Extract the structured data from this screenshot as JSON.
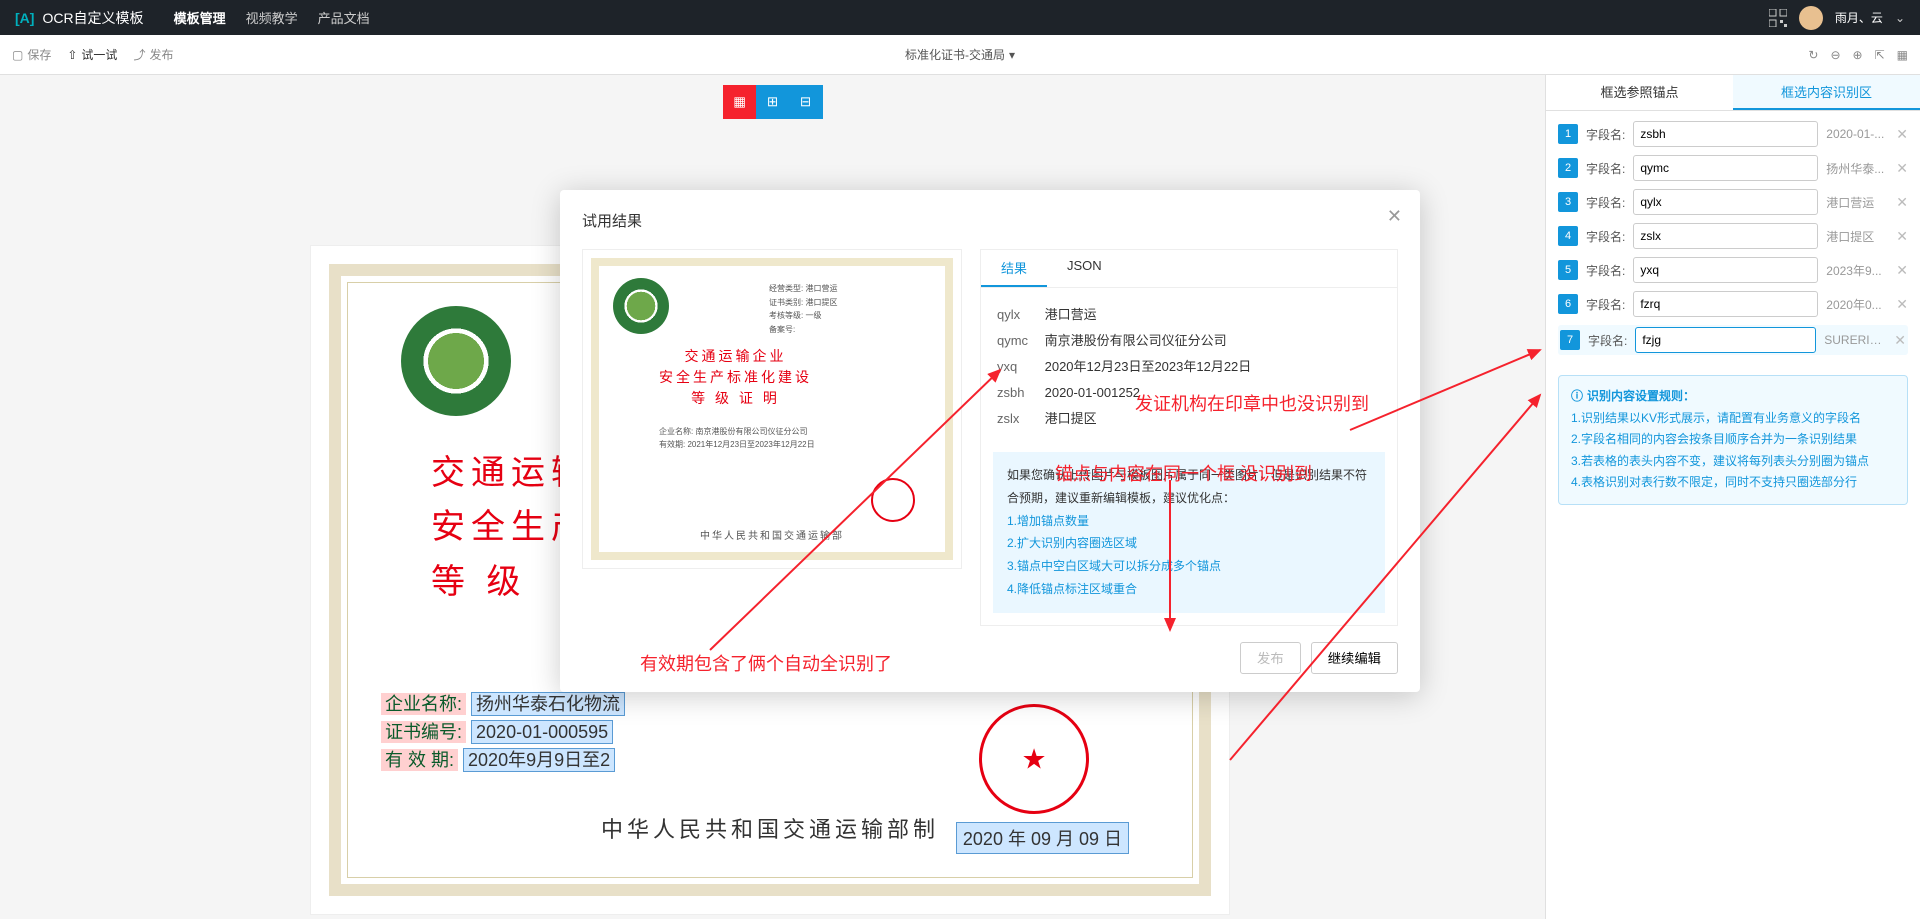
{
  "header": {
    "app_title": "OCR自定义模板",
    "nav": [
      "模板管理",
      "视频教学",
      "产品文档"
    ],
    "username": "雨月、云"
  },
  "toolbar": {
    "save": "保存",
    "try": "试一试",
    "publish": "发布",
    "doc_title": "标准化证书-交通局"
  },
  "certificate": {
    "title_line1": "交通运输",
    "title_line2": "安全生产标",
    "title_line3": "等 级",
    "label_company": "企业名称:",
    "val_company": "扬州华泰石化物流",
    "label_certno": "证书编号:",
    "val_certno": "2020-01-000595",
    "label_valid": "有 效 期:",
    "val_valid": "2020年9月9日至2",
    "footer": "中华人民共和国交通运输部制",
    "date_box": "2020 年 09 月 09 日"
  },
  "modal": {
    "title": "试用结果",
    "tabs": {
      "result": "结果",
      "json": "JSON"
    },
    "preview": {
      "title_l1": "交通运输企业",
      "title_l2": "安全生产标准化建设",
      "title_l3": "等 级 证 明",
      "r1": "经营类型:  港口营运",
      "r2": "证书类别:  港口提区",
      "r3": "考核等级:  一级",
      "r4": "备案号:",
      "foot": "中华人民共和国交通运输部",
      "company_line": "企业名称: 南京港股份有限公司仪征分公司",
      "valid_line": "有效期: 2021年12月23日至2023年12月22日"
    },
    "results": [
      {
        "k": "qylx",
        "v": "港口营运"
      },
      {
        "k": "qymc",
        "v": "南京港股份有限公司仪征分公司"
      },
      {
        "k": "yxq",
        "v": "2020年12月23日至2023年12月22日"
      },
      {
        "k": "zsbh",
        "v": "2020-01-001252"
      },
      {
        "k": "zslx",
        "v": "港口提区"
      }
    ],
    "tips_head": "如果您确认上传图片与模板图片属于同一类图片，但是识别结果不符合预期，建议重新编辑模板，建议优化点：",
    "tips": [
      "1.增加锚点数量",
      "2.扩大识别内容圈选区域",
      "3.锚点中空白区域大可以拆分成多个锚点",
      "4.降低锚点标注区域重合"
    ],
    "btn_publish": "发布",
    "btn_continue": "继续编辑"
  },
  "annotations": {
    "a1": "发证机构在印章中也没识别到",
    "a2": "锚点与内容在同一个框 没识别到",
    "a3": "有效期包含了俩个自动全识别了"
  },
  "sidebar": {
    "tab_anchor": "框选参照锚点",
    "tab_content": "框选内容识别区",
    "field_label": "字段名:",
    "fields": [
      {
        "n": "1",
        "name": "zsbh",
        "val": "2020-01-..."
      },
      {
        "n": "2",
        "name": "qymc",
        "val": "扬州华泰..."
      },
      {
        "n": "3",
        "name": "qylx",
        "val": "港口营运"
      },
      {
        "n": "4",
        "name": "zslx",
        "val": "港口提区"
      },
      {
        "n": "5",
        "name": "yxq",
        "val": "2023年9..."
      },
      {
        "n": "6",
        "name": "fzrq",
        "val": "2020年0..."
      },
      {
        "n": "7",
        "name": "fzjg",
        "val": "SURERING"
      }
    ],
    "rules_title": "识别内容设置规则：",
    "rules": [
      "1.识别结果以KV形式展示，请配置有业务意义的字段名",
      "2.字段名相同的内容会按条目顺序合并为一条识别结果",
      "3.若表格的表头内容不变，建议将每列表头分别圈为锚点",
      "4.表格识别对表行数不限定，同时不支持只圈选部分行"
    ]
  }
}
